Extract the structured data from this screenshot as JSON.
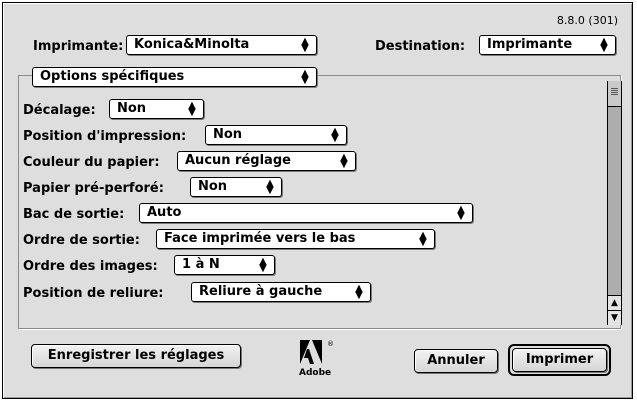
{
  "version": "8.8.0 (301)",
  "printer": {
    "label": "Imprimante:",
    "value": "Konica&Minolta"
  },
  "destination": {
    "label": "Destination:",
    "value": "Imprimante"
  },
  "section": {
    "value": "Options spécifiques"
  },
  "options": [
    {
      "label": "Décalage:",
      "value": "Non"
    },
    {
      "label": "Position d'impression:",
      "value": "Non"
    },
    {
      "label": "Couleur du papier:",
      "value": "Aucun réglage"
    },
    {
      "label": "Papier pré-perforé:",
      "value": "Non"
    },
    {
      "label": "Bac de sortie:",
      "value": "Auto"
    },
    {
      "label": "Ordre de sortie:",
      "value": "Face imprimée vers le bas"
    },
    {
      "label": "Ordre des images:",
      "value": "1 à N"
    },
    {
      "label": "Position de reliure:",
      "value": "Reliure à gauche"
    }
  ],
  "buttons": {
    "save": "Enregistrer les réglages",
    "cancel": "Annuler",
    "print": "Imprimer"
  },
  "logo": {
    "text": "Adobe",
    "mark": "®"
  }
}
